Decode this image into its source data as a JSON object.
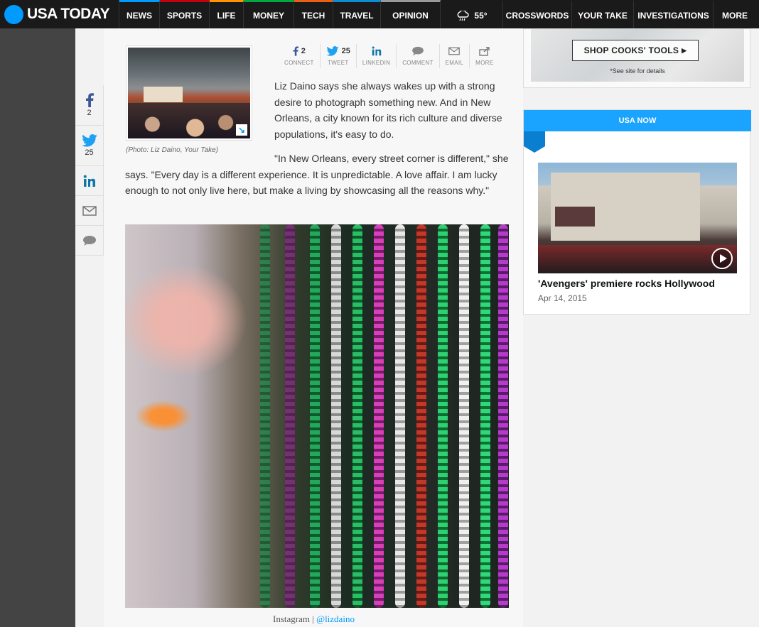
{
  "nav": {
    "logo": "USA TODAY",
    "items": [
      "NEWS",
      "SPORTS",
      "LIFE",
      "MONEY",
      "TECH",
      "TRAVEL",
      "OPINION"
    ],
    "weather_temp": "55°",
    "extra": [
      "CROSSWORDS",
      "YOUR TAKE",
      "INVESTIGATIONS",
      "MORE"
    ]
  },
  "share_rail": {
    "facebook_count": "2",
    "twitter_count": "25"
  },
  "share_bar": {
    "facebook_count": "2",
    "twitter_count": "25",
    "labels": [
      "CONNECT",
      "TWEET",
      "LINKEDIN",
      "COMMENT",
      "EMAIL",
      "MORE"
    ]
  },
  "article": {
    "caption": "(Photo: Liz Daino, Your Take)",
    "p1": "Liz Daino says she always wakes up with a strong desire to photograph something new. And in New Orleans, a city known for its rich culture and diverse populations, it's easy to do.",
    "p2": "\"In New Orleans, every street corner is different,\" she says. \"Every day is a different experience. It is unpredictable. A love affair. I am lucky enough to not only live here, but make a living by showcasing all the reasons why.\"",
    "photo_credit_source": "Instagram",
    "photo_credit_separator": " | ",
    "photo_credit_handle": "@lizdaino"
  },
  "ad": {
    "button": "SHOP COOKS' TOOLS",
    "note": "*See site for details"
  },
  "usa_now": {
    "header": "USA NOW",
    "video_title": "'Avengers' premiere rocks Hollywood",
    "video_date": "Apr 14, 2015"
  },
  "colors": {
    "brand_blue": "#009bff",
    "nav_bg": "#1a1a1a",
    "usa_now_blue": "#1aa3ff"
  }
}
